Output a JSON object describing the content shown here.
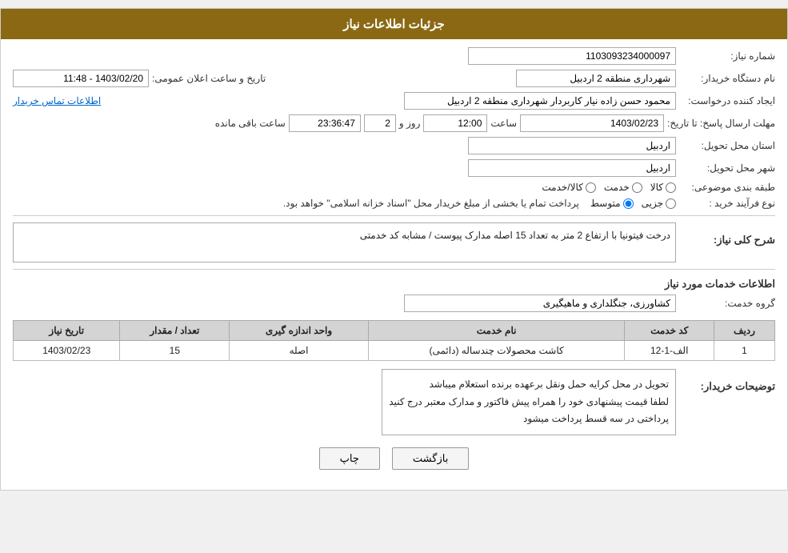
{
  "header": {
    "title": "جزئیات اطلاعات نیاز"
  },
  "fields": {
    "reference_number_label": "شماره نیاز:",
    "reference_number_value": "1103093234000097",
    "requester_org_label": "نام دستگاه خریدار:",
    "requester_org_value": "شهرداری منطقه 2 اردبیل",
    "date_announce_label": "تاریخ و ساعت اعلان عمومی:",
    "date_announce_value": "1403/02/20 - 11:48",
    "creator_label": "ایجاد کننده درخواست:",
    "creator_value": "محمود حسن زاده نیار کاربردار شهرداری منطقه 2 اردبیل",
    "contact_link": "اطلاعات تماس خریدار",
    "response_date_label": "مهلت ارسال پاسخ: تا تاریخ:",
    "response_date_value": "1403/02/23",
    "response_time_label": "ساعت",
    "response_time_value": "12:00",
    "response_days_label": "روز و",
    "response_days_value": "2",
    "response_remaining_label": "ساعت باقی مانده",
    "response_remaining_value": "23:36:47",
    "province_label": "استان محل تحویل:",
    "province_value": "اردبیل",
    "city_label": "شهر محل تحویل:",
    "city_value": "اردبیل",
    "category_label": "طبقه بندی موضوعی:",
    "category_kala": "کالا",
    "category_khedmat": "خدمت",
    "category_kala_khedmat": "کالا/خدمت",
    "purchase_type_label": "نوع فرآیند خرید :",
    "purchase_type_jozyi": "جزیی",
    "purchase_type_motavasset": "متوسط",
    "purchase_type_desc": "پرداخت تمام یا بخشی از مبلغ خریدار محل \"اسناد خزانه اسلامی\" خواهد بود.",
    "need_desc_label": "شرح کلی نیاز:",
    "need_desc_value": "درخت فیتونیا  با ارتفاع 2 متر به تعداد 15 اصله\nمدارک پیوست / مشابه کد خدمتی",
    "services_section_label": "اطلاعات خدمات مورد نیاز",
    "service_group_label": "گروه خدمت:",
    "service_group_value": "کشاورزی، جنگلداری و ماهیگیری"
  },
  "table": {
    "columns": [
      "ردیف",
      "کد خدمت",
      "نام خدمت",
      "واحد اندازه گیری",
      "تعداد / مقدار",
      "تاریخ نیاز"
    ],
    "rows": [
      {
        "row": "1",
        "code": "الف-1-12",
        "name": "کاشت محصولات چندساله (دائمی)",
        "unit": "اصله",
        "quantity": "15",
        "date": "1403/02/23"
      }
    ]
  },
  "buyer_notes_label": "توضیحات خریدار:",
  "buyer_notes_value": "تحویل در محل کرایه حمل ونقل برعهده برنده استعلام میباشد\nلطفا قیمت پیشنهادی خود را همراه پیش فاکتور و مدارک معتبر درج کنید\nپرداختی در سه قسط پرداخت میشود",
  "buttons": {
    "back_label": "بازگشت",
    "print_label": "چاپ"
  }
}
